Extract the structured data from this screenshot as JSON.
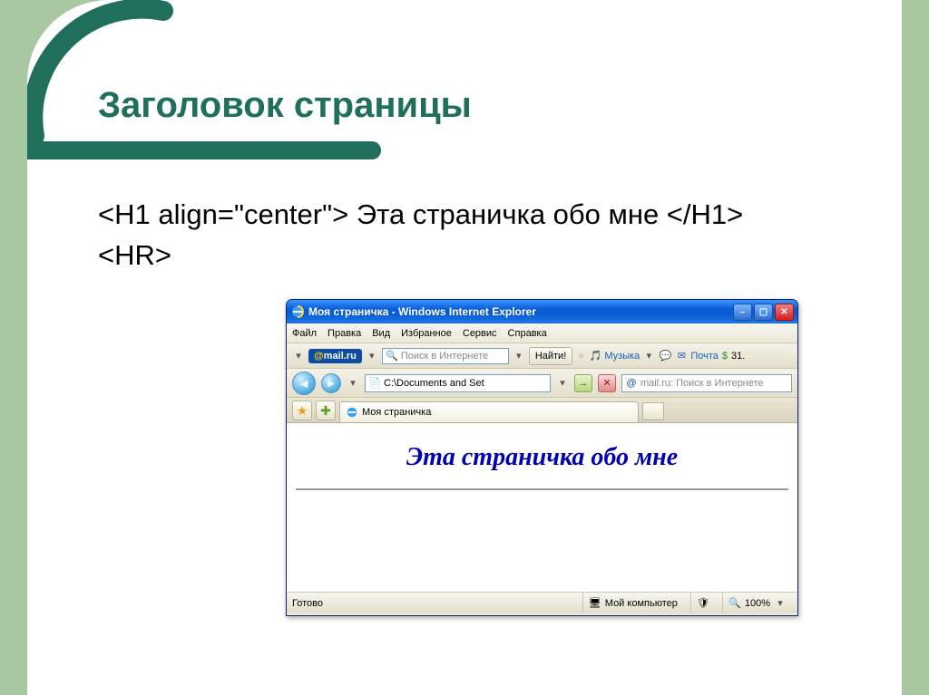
{
  "slide": {
    "heading": "Заголовок страницы",
    "code_line1": "<H1 align=\"center\"> Эта страничка обо мне </H1>",
    "code_line2": "<HR>"
  },
  "ie": {
    "title": "Моя страничка - Windows Internet Explorer",
    "menu": {
      "file": "Файл",
      "edit": "Правка",
      "view": "Вид",
      "favorites": "Избранное",
      "tools": "Сервис",
      "help": "Справка"
    },
    "toolbar": {
      "mailru_logo": "@mail.ru",
      "search_placeholder": "Поиск в Интернете",
      "find_button": "Найти!",
      "music": "Музыка",
      "mail_label": "Почта",
      "extra": "31."
    },
    "address": {
      "value": "C:\\Documents and Set",
      "mailru_placeholder": "mail.ru: Поиск в Интернете"
    },
    "tab": {
      "label": "Моя страничка"
    },
    "page": {
      "h1": "Эта страничка обо мне"
    },
    "status": {
      "ready": "Готово",
      "zone": "Мой компьютер",
      "zoom": "100%"
    }
  }
}
